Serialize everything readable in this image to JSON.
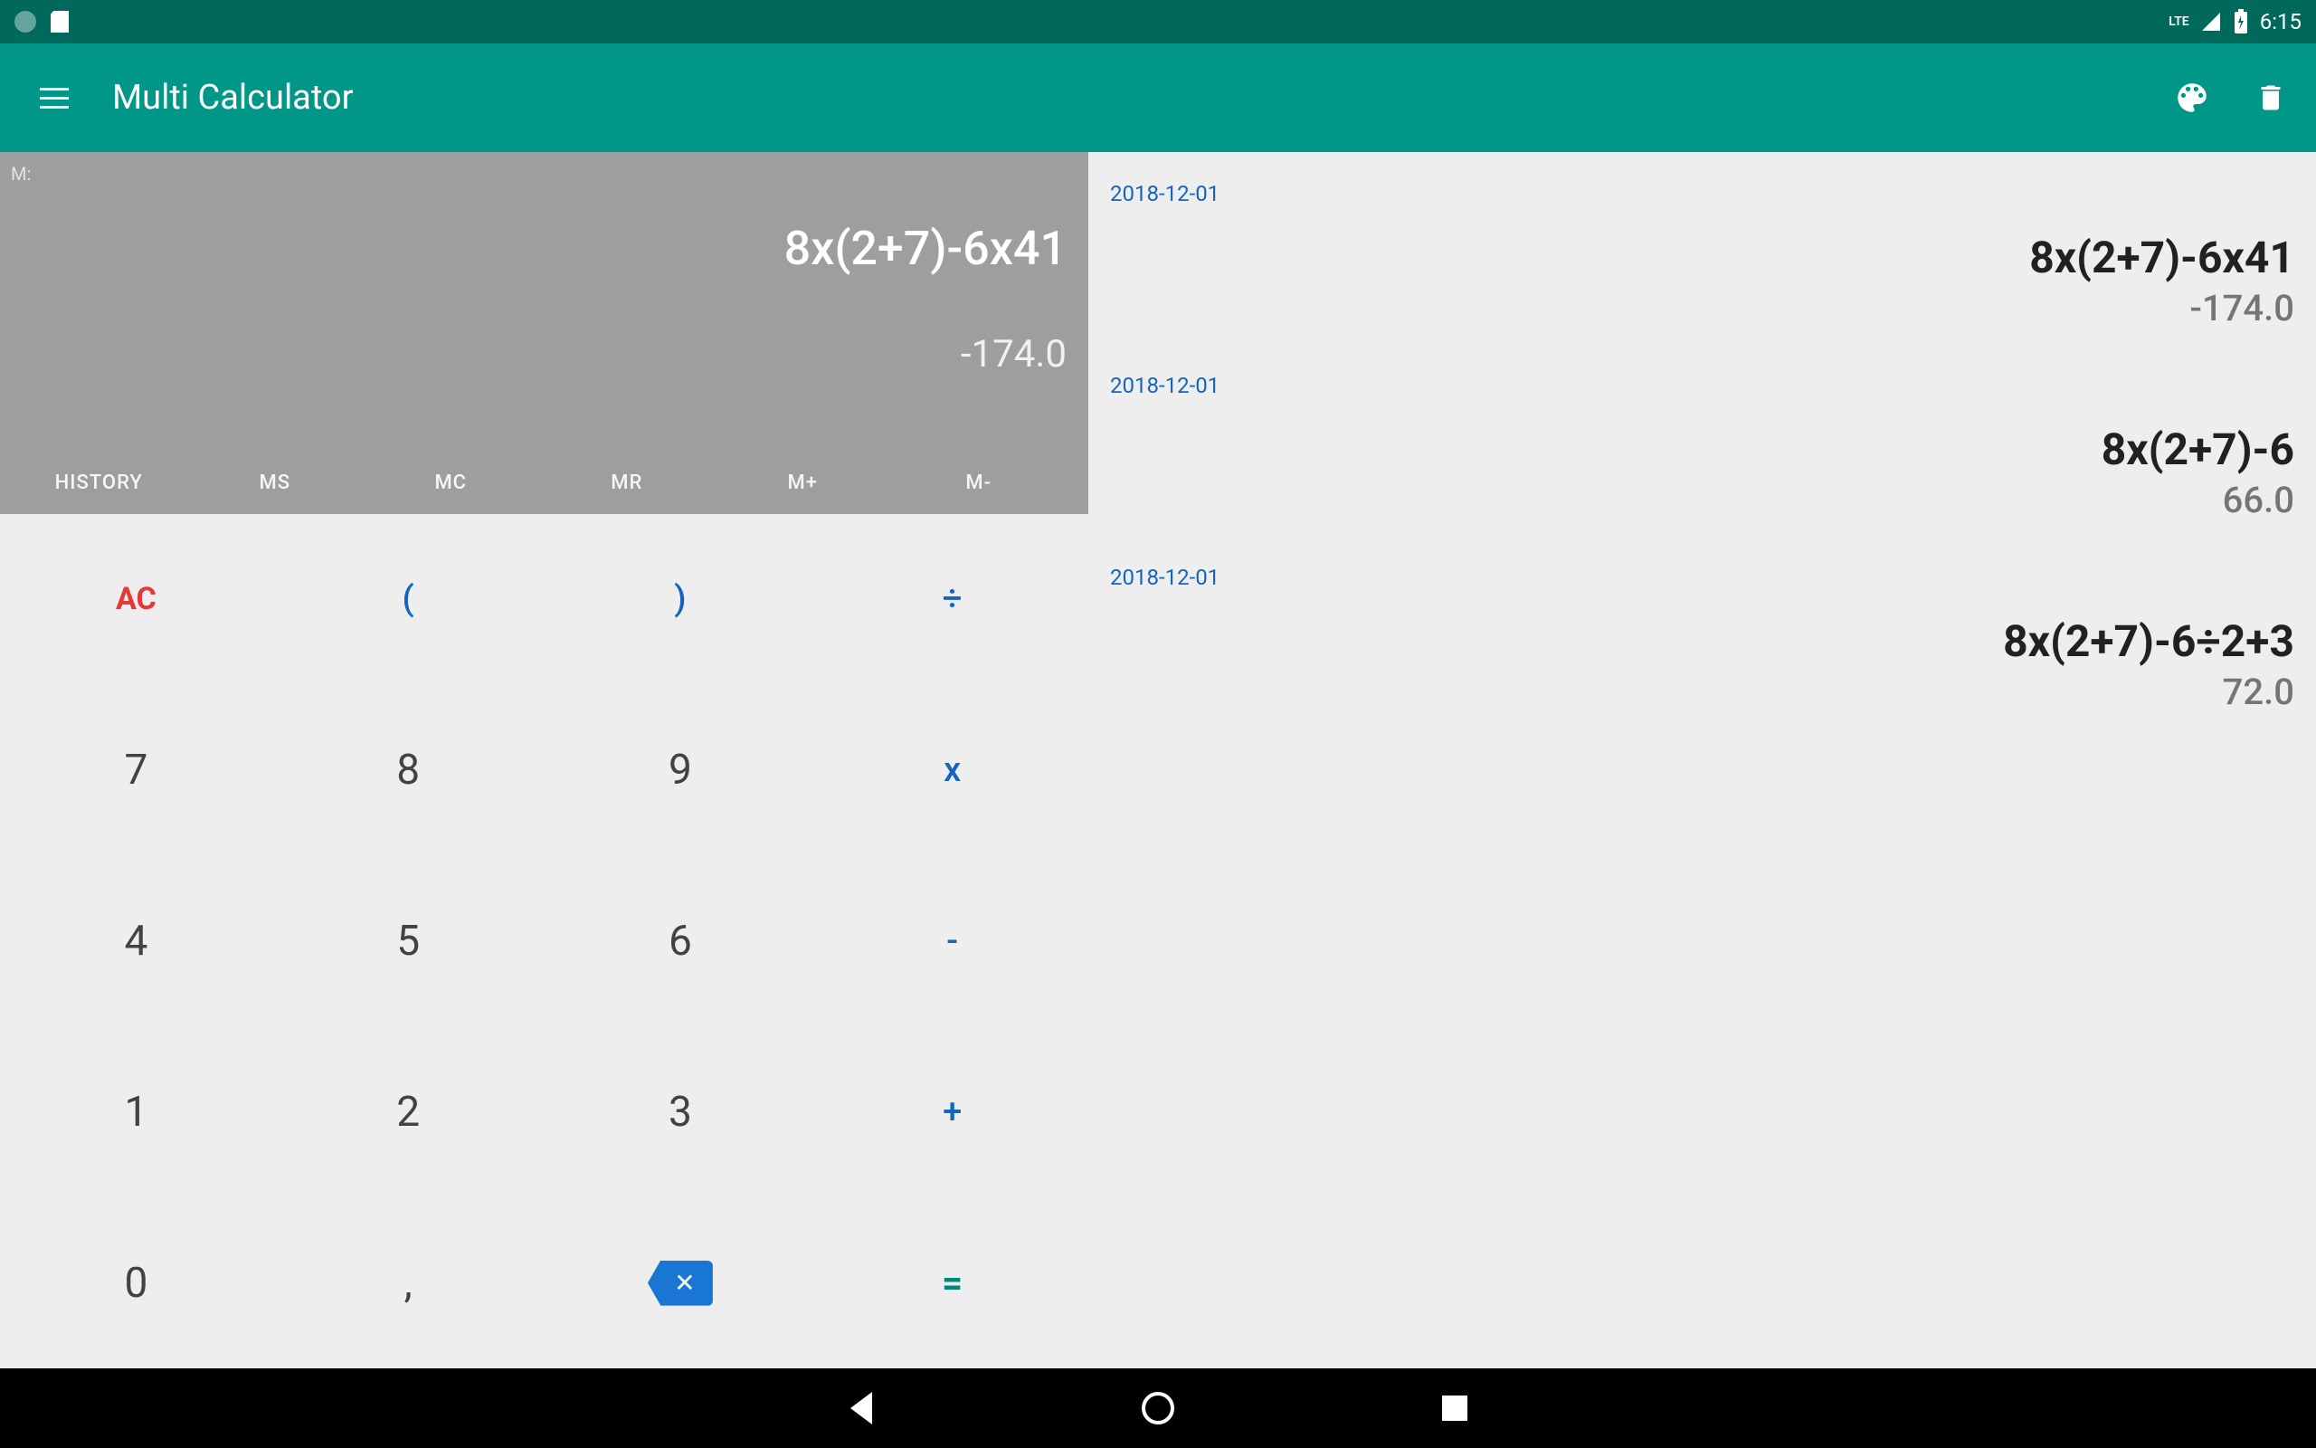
{
  "statusBar": {
    "lte": "LTE",
    "time": "6:15"
  },
  "appBar": {
    "title": "Multi Calculator"
  },
  "display": {
    "memLabel": "M:",
    "expression": "8x(2+7)-6x41",
    "result": "-174.0"
  },
  "memoryButtons": {
    "history": "HISTORY",
    "ms": "MS",
    "mc": "MC",
    "mr": "MR",
    "mplus": "M+",
    "mminus": "M-"
  },
  "keypad": {
    "ac": "AC",
    "lparen": "(",
    "rparen": ")",
    "divide": "÷",
    "k7": "7",
    "k8": "8",
    "k9": "9",
    "multiply": "x",
    "k4": "4",
    "k5": "5",
    "k6": "6",
    "minus": "-",
    "k1": "1",
    "k2": "2",
    "k3": "3",
    "plus": "+",
    "k0": "0",
    "comma": ",",
    "backspace": "✕",
    "equals": "="
  },
  "history": [
    {
      "date": "2018-12-01",
      "expr": "8x(2+7)-6x41",
      "result": "-174.0"
    },
    {
      "date": "2018-12-01",
      "expr": "8x(2+7)-6",
      "result": "66.0"
    },
    {
      "date": "2018-12-01",
      "expr": "8x(2+7)-6÷2+3",
      "result": "72.0"
    }
  ]
}
